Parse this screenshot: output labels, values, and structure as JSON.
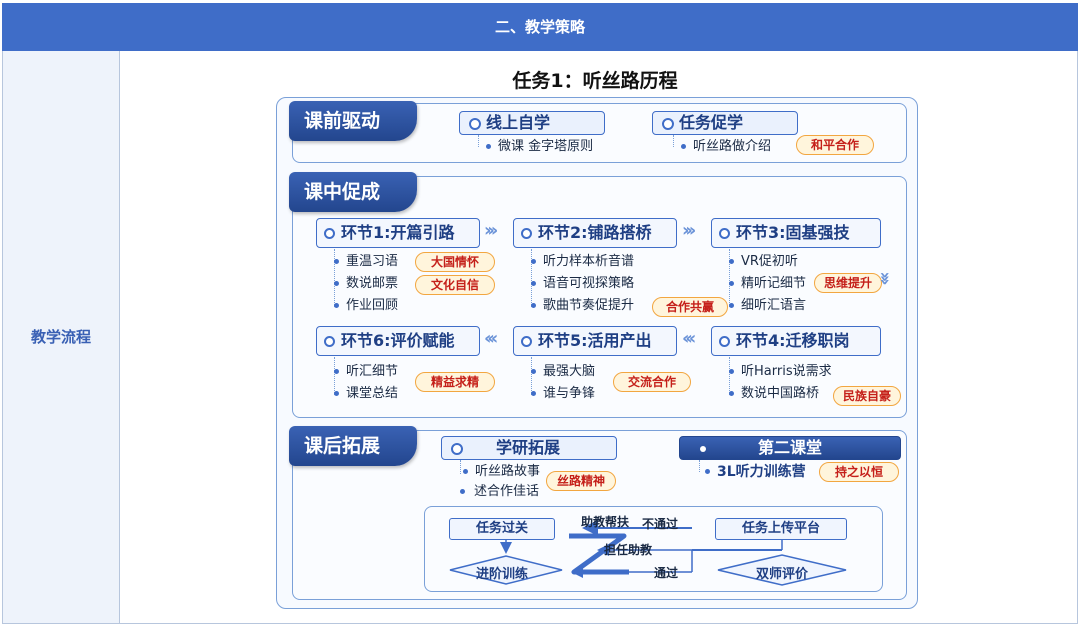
{
  "header": {
    "title": "二、教学策略"
  },
  "row": {
    "label": "教学流程"
  },
  "diagram": {
    "title": "任务1：听丝路历程",
    "pre": {
      "tab": "课前驱动",
      "pill1": "线上自学",
      "pill1_item": "微课 金字塔原则",
      "pill2": "任务促学",
      "pill2_item": "听丝路做介绍",
      "pill2_badge": "和平合作"
    },
    "mid": {
      "tab": "课中促成",
      "stages": [
        {
          "title": "环节1:开篇引路",
          "items": [
            "重温习语",
            "数说邮票",
            "作业回顾"
          ],
          "badges": [
            "大国情怀",
            "文化自信"
          ]
        },
        {
          "title": "环节2:铺路搭桥",
          "items": [
            "听力样本析音谱",
            "语音可视探策略",
            "歌曲节奏促提升"
          ],
          "badges": [
            "合作共赢"
          ]
        },
        {
          "title": "环节3:固基强技",
          "items": [
            "VR促初听",
            "精听记细节",
            "细听汇语言"
          ],
          "badges": [
            "思维提升"
          ]
        },
        {
          "title": "环节4:迁移职岗",
          "items": [
            "听Harris说需求",
            "数说中国路桥"
          ],
          "badges": [
            "民族自豪"
          ]
        },
        {
          "title": "环节5:活用产出",
          "items": [
            "最强大脑",
            "谁与争锋"
          ],
          "badges": [
            "交流合作"
          ]
        },
        {
          "title": "环节6:评价赋能",
          "items": [
            "听汇细节",
            "课堂总结"
          ],
          "badges": [
            "精益求精"
          ]
        }
      ]
    },
    "post": {
      "tab": "课后拓展",
      "pill1": "学研拓展",
      "pill1_items": [
        "听丝路故事",
        "述合作佳话"
      ],
      "pill1_badge": "丝路精神",
      "pill2": "第二课堂",
      "pill2_item": "3L听力训练营",
      "pill2_badge": "持之以恒",
      "flow": {
        "task_pass": "任务过关",
        "advanced": "进阶训练",
        "upload": "任务上传平台",
        "dual_eval": "双师评价",
        "assist": "助教帮扶",
        "fail": "不通过",
        "serve": "担任助教",
        "pass": "通过"
      }
    }
  },
  "colors": {
    "accent": "#3f6dc8",
    "dark": "#23468e",
    "badge_text": "#c5201a",
    "badge_border": "#f2a640"
  }
}
